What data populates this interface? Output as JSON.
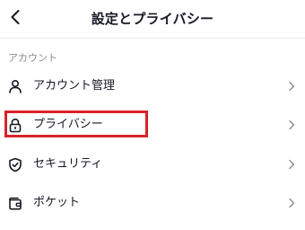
{
  "header": {
    "title": "設定とプライバシー",
    "back_icon": "chevron-left-icon"
  },
  "section": {
    "label": "アカウント"
  },
  "items": [
    {
      "label": "アカウント管理",
      "icon": "person-icon"
    },
    {
      "label": "プライバシー",
      "icon": "lock-icon"
    },
    {
      "label": "セキュリティ",
      "icon": "shield-icon"
    },
    {
      "label": "ポケット",
      "icon": "wallet-icon"
    }
  ],
  "colors": {
    "highlight": "#d8232a",
    "text": "#161823",
    "muted": "#8a8b91",
    "chevron": "#8a8b91"
  }
}
